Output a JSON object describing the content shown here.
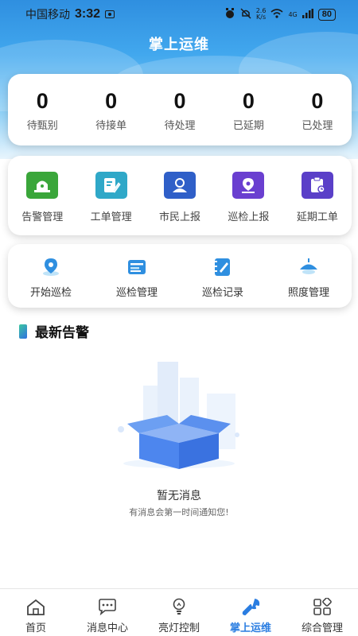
{
  "status_bar": {
    "carrier": "中国移动",
    "time": "3:32",
    "network_speed": "2.6\nK/s",
    "signal": "4G",
    "battery": "80"
  },
  "nav": {
    "title": "掌上运维"
  },
  "stats": [
    {
      "value": "0",
      "label": "待甄别"
    },
    {
      "value": "0",
      "label": "待接单"
    },
    {
      "value": "0",
      "label": "待处理"
    },
    {
      "value": "0",
      "label": "已延期"
    },
    {
      "value": "0",
      "label": "已处理"
    }
  ],
  "quick_menu": [
    {
      "label": "告警管理",
      "icon": "alarm-light-icon",
      "color": "#3aa63a"
    },
    {
      "label": "工单管理",
      "icon": "edit-order-icon",
      "color": "#2fa8c8"
    },
    {
      "label": "市民上报",
      "icon": "citizen-icon",
      "color": "#2f5fc8"
    },
    {
      "label": "巡检上报",
      "icon": "location-pin-icon",
      "color": "#6a3fd0"
    },
    {
      "label": "延期工单",
      "icon": "clipboard-clock-icon",
      "color": "#5a3fc8"
    }
  ],
  "patrol_menu": [
    {
      "label": "开始巡检",
      "icon": "map-pin-icon"
    },
    {
      "label": "巡检管理",
      "icon": "list-card-icon"
    },
    {
      "label": "巡检记录",
      "icon": "notebook-pen-icon"
    },
    {
      "label": "照度管理",
      "icon": "lamp-icon"
    }
  ],
  "alerts": {
    "title": "最新告警",
    "empty_title": "暂无消息",
    "empty_subtitle": "有消息会第一时间通知您!"
  },
  "tabbar": [
    {
      "label": "首页",
      "icon": "home-icon",
      "active": false
    },
    {
      "label": "消息中心",
      "icon": "chat-icon",
      "active": false
    },
    {
      "label": "亮灯控制",
      "icon": "bulb-icon",
      "active": false
    },
    {
      "label": "掌上运维",
      "icon": "wrench-icon",
      "active": true
    },
    {
      "label": "综合管理",
      "icon": "grid-icon",
      "active": false
    }
  ],
  "colors": {
    "accent": "#2a7de1",
    "header_top": "#2f8fe0"
  }
}
